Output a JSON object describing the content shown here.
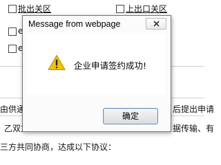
{
  "background": {
    "top_left_1": "批出关区",
    "top_right_1": "上出口关区",
    "left_fragment_1": "e",
    "left_fragment_2": "e",
    "line_1_left": "由供通关",
    "line_1_right": "后提出申请",
    "line_2_left": "乙双方",
    "line_2_right": "据传输、有",
    "line_3": "三方共同协商，达成以下协议："
  },
  "dialog": {
    "title": "Message from webpage",
    "message": "企业申请签约成功!",
    "ok_label": "确定",
    "icon": "warning-icon"
  },
  "colors": {
    "warning_fill": "#f2c400",
    "button_border": "#6b8fb8"
  }
}
